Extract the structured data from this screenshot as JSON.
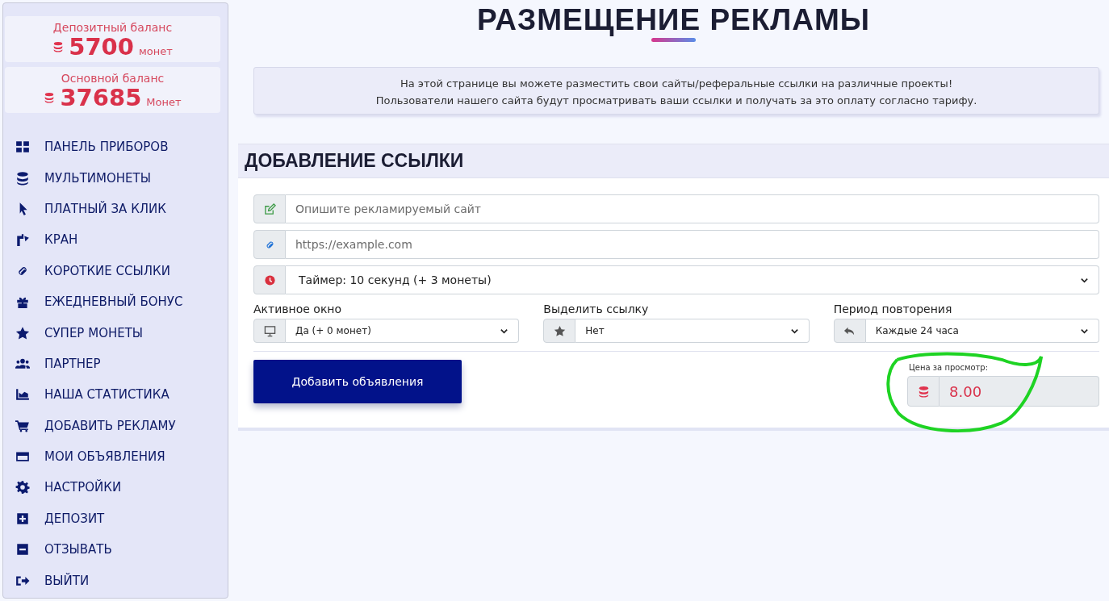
{
  "sidebar": {
    "balances": [
      {
        "label": "Депозитный баланс",
        "amount": "5700",
        "unit": "монет"
      },
      {
        "label": "Основной баланс",
        "amount": "37685",
        "unit": "Монет"
      }
    ],
    "items": [
      {
        "label": "ПАНЕЛЬ ПРИБОРОВ"
      },
      {
        "label": "МУЛЬТИМОНЕТЫ"
      },
      {
        "label": "ПЛАТНЫЙ ЗА КЛИК"
      },
      {
        "label": "КРАН"
      },
      {
        "label": "КОРОТКИЕ ССЫЛКИ"
      },
      {
        "label": "ЕЖЕДНЕВНЫЙ БОНУС"
      },
      {
        "label": "СУПЕР МОНЕТЫ"
      },
      {
        "label": "ПАРТНЕР"
      },
      {
        "label": "НАША СТАТИСТИКА"
      },
      {
        "label": "ДОБАВИТЬ РЕКЛАМУ"
      },
      {
        "label": "МОИ ОБЪЯВЛЕНИЯ"
      },
      {
        "label": "НАСТРОЙКИ"
      },
      {
        "label": "ДЕПОЗИТ"
      },
      {
        "label": "ОТЗЫВАТЬ"
      },
      {
        "label": "ВЫЙТИ"
      }
    ]
  },
  "page_title": "РАЗМЕЩЕНИЕ РЕКЛАМЫ",
  "info": [
    "На этой странице вы можете разместить свои сайты/реферальные ссылки на различные проекты!",
    "Пользователи нашего сайта будут просматривать ваши ссылки и получать за это оплату согласно тарифу."
  ],
  "form": {
    "title": "ДОБАВЛЕНИЕ ССЫЛКИ",
    "description": {
      "placeholder": "Опишите рекламируемый сайт"
    },
    "url": {
      "placeholder": "https://example.com"
    },
    "timer": {
      "value": "Таймер: 10 секунд (+ 3 монеты)"
    },
    "options": [
      {
        "label": "Активное окно",
        "value": "Да (+ 0 монет)"
      },
      {
        "label": "Выделить ссылку",
        "value": "Нет"
      },
      {
        "label": "Период повторения",
        "value": "Каждые 24 часа"
      }
    ],
    "submit": "Добавить объявления",
    "price": {
      "label": "Цена за просмотр:",
      "value": "8.00"
    }
  }
}
